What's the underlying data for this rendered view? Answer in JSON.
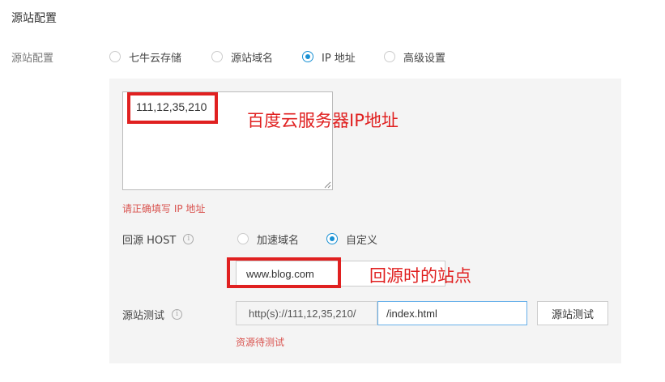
{
  "section": {
    "title": "源站配置"
  },
  "origin": {
    "label": "源站配置",
    "options": [
      {
        "label": "七牛云存储",
        "checked": false
      },
      {
        "label": "源站域名",
        "checked": false
      },
      {
        "label": "IP 地址",
        "checked": true
      },
      {
        "label": "高级设置",
        "checked": false
      }
    ]
  },
  "ip": {
    "value": "111,12,35,210",
    "error": "请正确填写 IP 地址"
  },
  "host": {
    "label": "回源 HOST",
    "options": [
      {
        "label": "加速域名",
        "checked": false
      },
      {
        "label": "自定义",
        "checked": true
      }
    ],
    "value": "www.blog.com"
  },
  "test": {
    "label": "源站测试",
    "prefix": "http(s)://111,12,35,210/",
    "path": "/index.html",
    "button_label": "源站测试",
    "status": "资源待测试"
  },
  "annotations": {
    "ip_note": "百度云服务器IP地址",
    "host_note": "回源时的站点",
    "color": "#e02020"
  },
  "colors": {
    "accent": "#1a91d4",
    "error": "#d9534f",
    "panel_bg": "#f4f4f4"
  }
}
